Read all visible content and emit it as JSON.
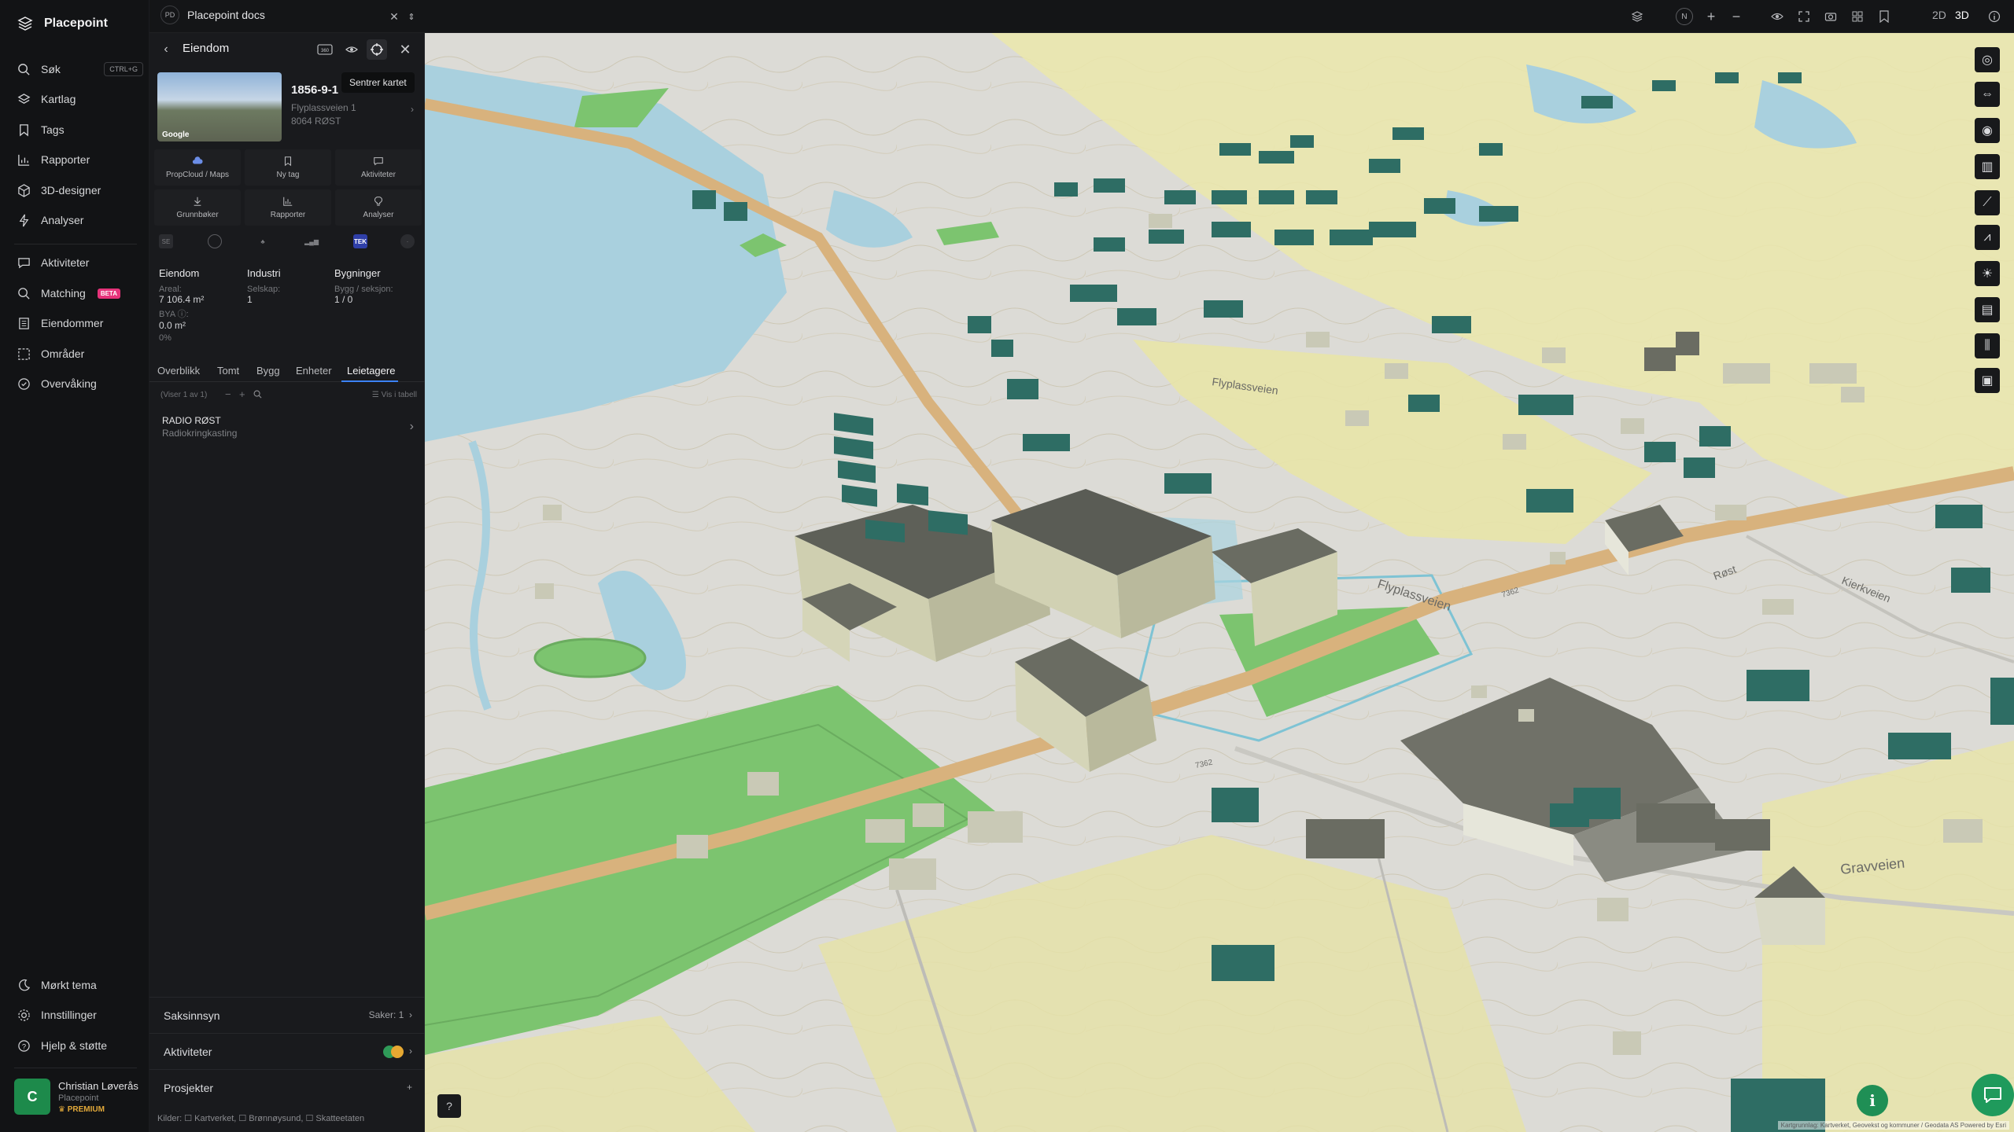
{
  "app": {
    "name": "Placepoint"
  },
  "nav": {
    "search": "Søk",
    "search_kbd": "CTRL+G",
    "layers": "Kartlag",
    "tags": "Tags",
    "reports": "Rapporter",
    "designer": "3D-designer",
    "analyses": "Analyser",
    "activities": "Aktiviteter",
    "matching": "Matching",
    "matching_badge": "BETA",
    "properties": "Eiendommer",
    "areas": "Områder",
    "monitoring": "Overvåking",
    "dark_theme": "Mørkt tema",
    "settings": "Innstillinger",
    "help": "Hjelp & støtte"
  },
  "user": {
    "initial": "C",
    "name": "Christian Løverås",
    "org": "Placepoint",
    "plan": "PREMIUM"
  },
  "topbar": {
    "doc_badge": "PD",
    "doc_title": "Placepoint docs",
    "mode_2d": "2D",
    "mode_3d": "3D",
    "compass_label": "N"
  },
  "panel": {
    "title": "Eiendom",
    "tooltip": "Sentrer kartet",
    "image_credit": "Google",
    "property_id": "1856-9-1",
    "address": "Flyplassveien 1",
    "postal": "8064 RØST",
    "actions": [
      {
        "label": "PropCloud / Maps",
        "icon": "cloud-icon"
      },
      {
        "label": "Ny tag",
        "icon": "bookmark-icon"
      },
      {
        "label": "Aktiviteter",
        "icon": "chat-icon"
      },
      {
        "label": "Grunnbøker",
        "icon": "download-icon"
      },
      {
        "label": "Rapporter",
        "icon": "chart-icon"
      },
      {
        "label": "Analyser",
        "icon": "bulb-icon"
      }
    ],
    "source_tag": "TEK",
    "stats": {
      "col1_head": "Eiendom",
      "area_label": "Areal:",
      "area_value": "7 106.4 m²",
      "bya_label": "BYA ⓘ:",
      "bya_value": "0.0 m²",
      "bya_pct": "0%",
      "col2_head": "Industri",
      "company_label": "Selskap:",
      "company_value": "1",
      "col3_head": "Bygninger",
      "bld_label": "Bygg / seksjon:",
      "bld_value": "1 / 0"
    },
    "tabs": [
      "Overblikk",
      "Tomt",
      "Bygg",
      "Enheter",
      "Leietagere"
    ],
    "list_count": "(Viser 1 av 1)",
    "list_table": "Vis i tabell",
    "tenant_name": "RADIO RØST",
    "tenant_sector": "Radiokringkasting",
    "acc_saksinnsyn": "Saksinnsyn",
    "acc_saker": "Saker: 1",
    "acc_aktiviteter": "Aktiviteter",
    "acc_prosjekter": "Prosjekter",
    "sources": "Kilder: ☐ Kartverket, ☐ Brønnøysund, ☐ Skatteetaten"
  },
  "map": {
    "road_flyplass": "Flyplassveien",
    "road_flyplass2": "Flyplassveien",
    "road_gravveien": "Gravveien",
    "road_kierkveien": "Kierkveien",
    "road_code_a": "7362",
    "road_code_b": "7362",
    "road_partial": "Røst",
    "attribution": "Kartgrunnlag: Kartverket, Geovekst og kommuner / Geodata AS Powered by Esri",
    "colors": {
      "water": "#a9d0de",
      "field": "#7cc46f",
      "yellow": "#ebe7ac",
      "road": "#d8b27d",
      "building_teal": "#2e6d64",
      "building_grey": "#6f7167"
    }
  }
}
